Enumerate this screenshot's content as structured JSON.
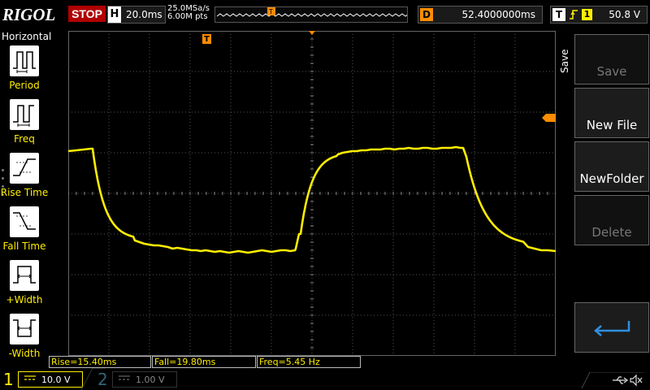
{
  "topbar": {
    "brand": "RIGOL",
    "run_state": "STOP",
    "horizontal": {
      "label": "H",
      "scale": "20.0ms"
    },
    "sample_rate": "25.0MSa/s",
    "memory_depth": "6.00M pts",
    "delay": {
      "label": "D",
      "value": "52.4000000ms"
    },
    "trigger": {
      "label": "T",
      "source": "1",
      "level": "50.8 V",
      "edge_icon": "rising-edge-icon"
    }
  },
  "left_panel": {
    "title": "Horizontal",
    "items": [
      {
        "label": "Period",
        "icon": "period-icon"
      },
      {
        "label": "Freq",
        "icon": "frequency-icon"
      },
      {
        "label": "Rise Time",
        "icon": "rise-time-icon"
      },
      {
        "label": "Fall Time",
        "icon": "fall-time-icon"
      },
      {
        "label": "+Width",
        "icon": "positive-width-icon"
      },
      {
        "label": "-Width",
        "icon": "negative-width-icon"
      }
    ]
  },
  "measurements": {
    "rise": "Rise=15.40ms",
    "fall": "Fall=19.80ms",
    "freq": "Freq=5.45 Hz"
  },
  "channels": {
    "ch1": {
      "number": "1",
      "coupling": "DC",
      "scale": "10.0 V",
      "color": "#ffee00"
    },
    "ch2": {
      "number": "2",
      "coupling": "DC",
      "scale": "1.00 V",
      "color": "#4da6c8"
    }
  },
  "right_menu": {
    "title": "Save",
    "buttons": [
      {
        "label": "Save",
        "enabled": false
      },
      {
        "label": "New File",
        "enabled": true
      },
      {
        "label": "NewFolder",
        "enabled": true
      },
      {
        "label": "Delete",
        "enabled": false
      },
      {
        "label": "",
        "icon": "back-arrow-icon",
        "enabled": true
      }
    ]
  },
  "markers": {
    "trigger_position": "T",
    "ch1_ground": "1"
  },
  "colors": {
    "trace": "#ffee00",
    "grid": "#555555",
    "stop": "#b00000",
    "delay_accent": "#ff8c00",
    "back_icon": "#2f8fe0"
  }
}
